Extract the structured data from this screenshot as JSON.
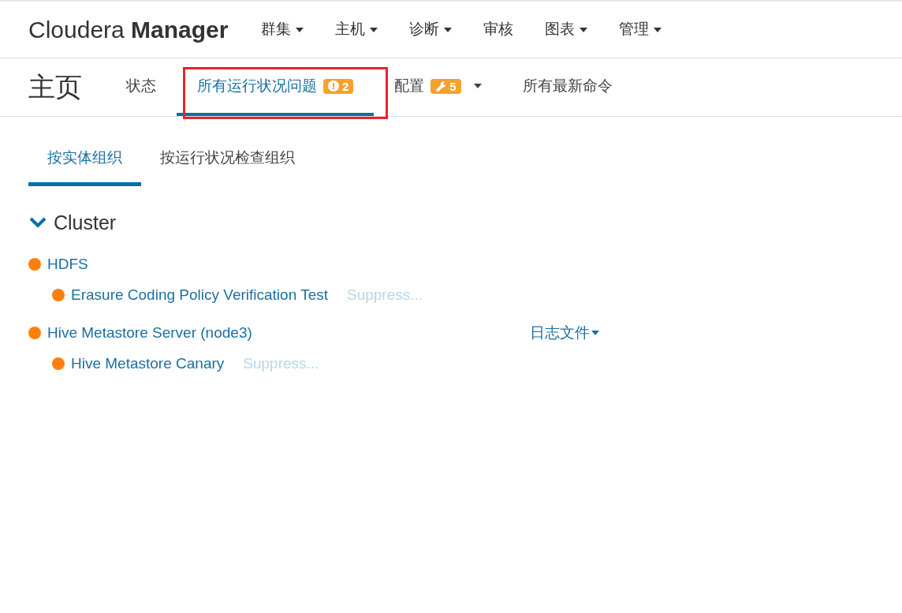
{
  "brand": {
    "light": "Cloudera",
    "bold": "Manager"
  },
  "top_menu": [
    {
      "label": "群集",
      "dropdown": true
    },
    {
      "label": "主机",
      "dropdown": true
    },
    {
      "label": "诊断",
      "dropdown": true
    },
    {
      "label": "审核",
      "dropdown": false
    },
    {
      "label": "图表",
      "dropdown": true
    },
    {
      "label": "管理",
      "dropdown": true
    }
  ],
  "page_title": "主页",
  "tabs": [
    {
      "label": "状态",
      "selected": false,
      "highlighted": false,
      "dropdown": false
    },
    {
      "label": "所有运行状况问题",
      "selected": true,
      "highlighted": true,
      "dropdown": false,
      "badge": {
        "kind": "alert",
        "count": "2"
      }
    },
    {
      "label": "配置",
      "selected": false,
      "highlighted": false,
      "dropdown": true,
      "badge": {
        "kind": "wrench",
        "count": "5"
      }
    },
    {
      "label": "所有最新命令",
      "selected": false,
      "highlighted": false,
      "dropdown": false
    }
  ],
  "sub_tabs": [
    {
      "label": "按实体组织",
      "selected": true
    },
    {
      "label": "按运行状况检查组织",
      "selected": false
    }
  ],
  "group": {
    "title": "Cluster",
    "expanded": true
  },
  "entities": [
    {
      "name": "HDFS",
      "color": "#ff7f0e",
      "checks": [
        {
          "name": "Erasure Coding Policy Verification Test",
          "color": "#ff7f0e",
          "action": "Suppress..."
        }
      ]
    },
    {
      "name": "Hive Metastore Server (node3)",
      "color": "#ff7f0e",
      "menu": "日志文件",
      "checks": [
        {
          "name": "Hive Metastore Canary",
          "color": "#ff7f0e",
          "action": "Suppress..."
        }
      ]
    }
  ]
}
